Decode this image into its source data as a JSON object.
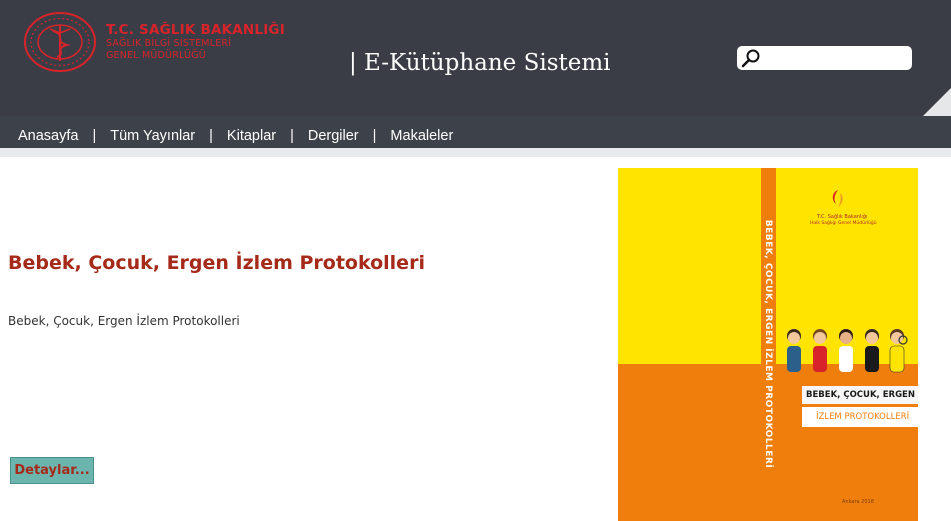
{
  "header": {
    "logo": {
      "line1": "T.C. SAĞLIK BAKANLIĞI",
      "line2": "SAĞLIK BİLGİ SİSTEMLERİ",
      "line3": "GENEL MÜDÜRLÜĞÜ"
    },
    "site_title": "| E-Kütüphane Sistemi",
    "search": {
      "value": "",
      "placeholder": ""
    }
  },
  "nav": {
    "items": [
      {
        "label": "Anasayfa"
      },
      {
        "label": "Tüm Yayınlar"
      },
      {
        "label": "Kitaplar"
      },
      {
        "label": "Dergiler"
      },
      {
        "label": "Makaleler"
      }
    ],
    "separator": "|"
  },
  "book": {
    "title": "Bebek, Çocuk, Ergen İzlem Protokolleri",
    "description": "Bebek, Çocuk, Ergen İzlem Protokolleri",
    "details_label": "Detaylar..."
  },
  "cover": {
    "spine_text": "BEBEK, ÇOCUK, ERGEN İZLEM PROTOKOLLERİ",
    "band_title": "BEBEK, ÇOCUK, ERGEN",
    "band_subtitle": "İZLEM PROTOKOLLERİ",
    "logo_line1": "T.C. Sağlık Bakanlığı",
    "logo_line2": "Halk Sağlığı Genel Müdürlüğü",
    "footer_text": "Ankara 2018"
  },
  "colors": {
    "header_bg": "#3a3d45",
    "accent_red": "#d8232a",
    "title_red": "#a52a1a",
    "button_teal": "#6cb4ae",
    "cover_yellow": "#ffe400",
    "cover_orange": "#f07e0c"
  }
}
